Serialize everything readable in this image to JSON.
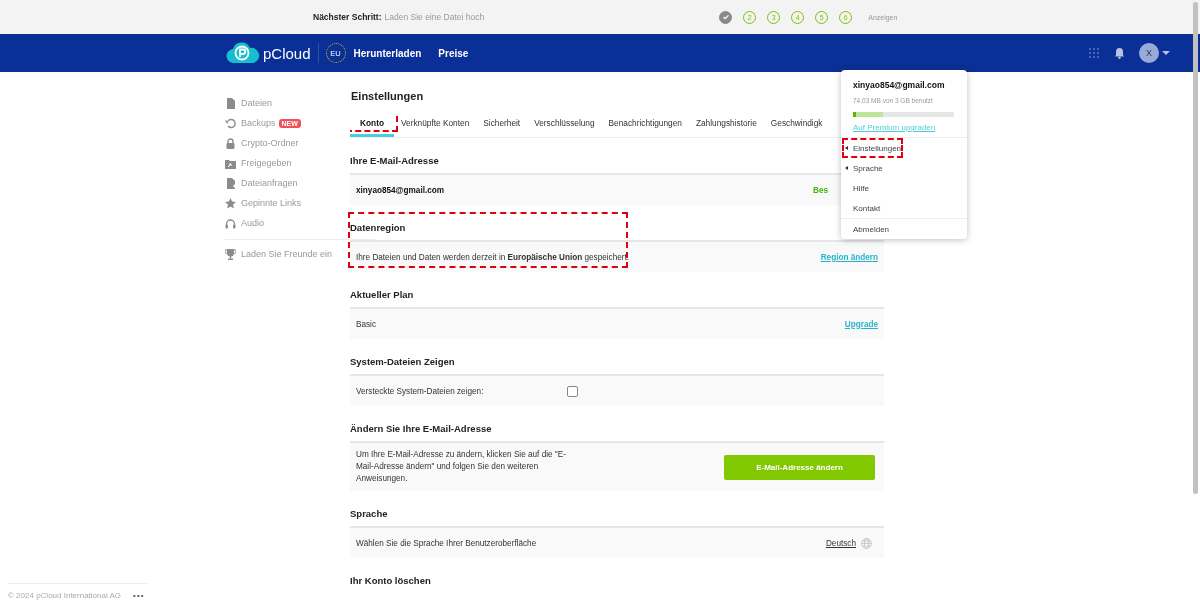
{
  "setup_bar": {
    "label": "Nächster Schritt:",
    "text": "Laden Sie eine Datei hoch",
    "steps": [
      {
        "done": true
      },
      {
        "number": "2",
        "done": false
      },
      {
        "number": "3",
        "done": false
      },
      {
        "number": "4",
        "done": false
      },
      {
        "number": "5",
        "done": false
      },
      {
        "number": "6",
        "done": false
      }
    ],
    "action": "Anzeigen"
  },
  "nav": {
    "brand": "pCloud",
    "region_badge": "EU",
    "links": [
      "Herunterladen",
      "Preise"
    ],
    "avatar": "X"
  },
  "sidebar": {
    "items": [
      {
        "label": "Dateien"
      },
      {
        "label": "Backups",
        "badge": "NEW"
      },
      {
        "label": "Crypto-Ordner"
      },
      {
        "label": "Freigegeben"
      },
      {
        "label": "Dateianfragen"
      },
      {
        "label": "Gepinnte Links"
      },
      {
        "label": "Audio"
      }
    ],
    "invite": "Laden Sie Freunde ein",
    "footer": {
      "copyright": "© 2024 pCloud International AG",
      "more": "•••"
    }
  },
  "settings": {
    "title": "Einstellungen",
    "tabs": [
      {
        "label": "Konto",
        "selected": true,
        "annotated": true
      },
      {
        "label": "Verknüpfte Konten",
        "selected": false,
        "annotated": false
      },
      {
        "label": "Sicherheit",
        "selected": false,
        "annotated": false
      },
      {
        "label": "Verschlüsselung",
        "selected": false,
        "annotated": false
      },
      {
        "label": "Benachrichtigungen",
        "selected": false,
        "annotated": false
      },
      {
        "label": "Zahlungshistorie",
        "selected": false,
        "annotated": false
      },
      {
        "label": "Geschwindigk",
        "selected": false,
        "annotated": false
      }
    ],
    "sections": [
      {
        "heading": "Ihre E-Mail-Adresse",
        "annotated": false,
        "row": {
          "kind": "email",
          "text": "xinyao854@gmail.com",
          "status": "Bes"
        }
      },
      {
        "heading": "Datenregion",
        "annotated": true,
        "row": {
          "kind": "link",
          "text": "Ihre Dateien und Daten werden derzeit in **Europäische Union** gespeichert.",
          "link": "Region ändern"
        }
      },
      {
        "heading": "Aktueller Plan",
        "annotated": false,
        "row": {
          "kind": "link",
          "text": "Basic",
          "link": "Upgrade"
        }
      },
      {
        "heading": "System-Dateien Zeigen",
        "annotated": false,
        "row": {
          "kind": "checkbox",
          "text": "Versteckte System-Dateien zeigen:",
          "checked": false
        }
      },
      {
        "heading": "Ändern Sie Ihre E-Mail-Adresse",
        "annotated": false,
        "row": {
          "kind": "button",
          "text": "Um Ihre E-Mail-Adresse zu ändern, klicken Sie auf die \"E-Mail-Adresse ändern\" und folgen Sie den weiteren Anweisungen.",
          "button": "E-Mail-Adresse ändern"
        }
      },
      {
        "heading": "Sprache",
        "annotated": false,
        "row": {
          "kind": "language",
          "text": "Wählen Sie die Sprache Ihrer Benutzeroberfläche",
          "link": "Deutsch"
        }
      },
      {
        "heading": "Ihr Konto löschen",
        "annotated": false
      }
    ]
  },
  "account_menu": {
    "email": "xinyao854@gmail.com",
    "usage": "74.03 MB von 3 GB benutzt",
    "usage_bar": [
      {
        "level": 0.03,
        "color": "#5cb800"
      },
      {
        "level": 0.27,
        "color": "#bfe39a"
      }
    ],
    "upgrade_link": "Auf Premium upgraden",
    "items": [
      {
        "label": "Einstellungen",
        "submenu": true,
        "separated": true,
        "annotated": true
      },
      {
        "label": "Sprache",
        "submenu": true,
        "separated": false,
        "annotated": false
      },
      {
        "label": "Hilfe",
        "submenu": false,
        "separated": false,
        "annotated": false
      },
      {
        "label": "Kontakt",
        "submenu": false,
        "separated": false,
        "annotated": false
      },
      {
        "label": "Abmelden",
        "submenu": false,
        "separated": true,
        "annotated": false
      }
    ]
  }
}
